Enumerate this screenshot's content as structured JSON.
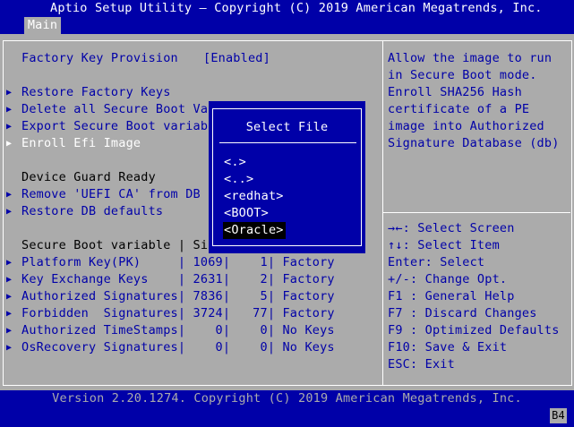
{
  "header": {
    "title": "Aptio Setup Utility – Copyright (C) 2019 American Megatrends, Inc.",
    "tabs": [
      {
        "label": "Main"
      }
    ]
  },
  "menu": {
    "factory_key_label": "Factory Key Provision",
    "factory_key_value": "[Enabled]",
    "restore_factory_keys": "Restore Factory Keys",
    "delete_all": "Delete all Secure Boot Var",
    "export_secure": "Export Secure Boot variabl",
    "enroll_efi": "Enroll Efi Image",
    "device_guard": "Device Guard Ready",
    "remove_uefi_ca": "Remove 'UEFI CA' from DB",
    "restore_db": "Restore DB defaults",
    "table_header": "Secure Boot variable | Siz",
    "rows": [
      {
        "text": "Platform Key(PK)     | 1069|    1| Factory"
      },
      {
        "text": "Key Exchange Keys    | 2631|    2| Factory"
      },
      {
        "text": "Authorized Signatures| 7836|    5| Factory"
      },
      {
        "text": "Forbidden  Signatures| 3724|   77| Factory"
      },
      {
        "text": "Authorized TimeStamps|    0|    0| No Keys"
      },
      {
        "text": "OsRecovery Signatures|    0|    0| No Keys"
      }
    ]
  },
  "help": {
    "lines": [
      "Allow the image to run",
      "in Secure Boot mode.",
      "Enroll SHA256 Hash",
      "certificate of a PE",
      "image into Authorized",
      "Signature Database (db)"
    ]
  },
  "keys": [
    {
      "key": "→←:",
      "desc": " Select Screen"
    },
    {
      "key": "↑↓:",
      "desc": " Select Item"
    },
    {
      "key": "Enter:",
      "desc": " Select"
    },
    {
      "key": "+/-:",
      "desc": " Change Opt."
    },
    {
      "key": "F1 :",
      "desc": " General Help"
    },
    {
      "key": "F7 :",
      "desc": " Discard Changes"
    },
    {
      "key": "F9 :",
      "desc": " Optimized Defaults"
    },
    {
      "key": "F10:",
      "desc": " Save & Exit"
    },
    {
      "key": "ESC:",
      "desc": " Exit"
    }
  ],
  "popup": {
    "title": "Select File",
    "options": [
      "<.>",
      "<..>",
      "<redhat>",
      "<BOOT>",
      "<Oracle>"
    ],
    "selected": "<Oracle>"
  },
  "footer": {
    "version": "Version 2.20.1274. Copyright (C) 2019 American Megatrends, Inc.",
    "badge": "B4"
  },
  "colors": {
    "background": "#ababab",
    "header_blue": "#0000a8",
    "text_white": "#ffffff",
    "selection": "#000000"
  }
}
